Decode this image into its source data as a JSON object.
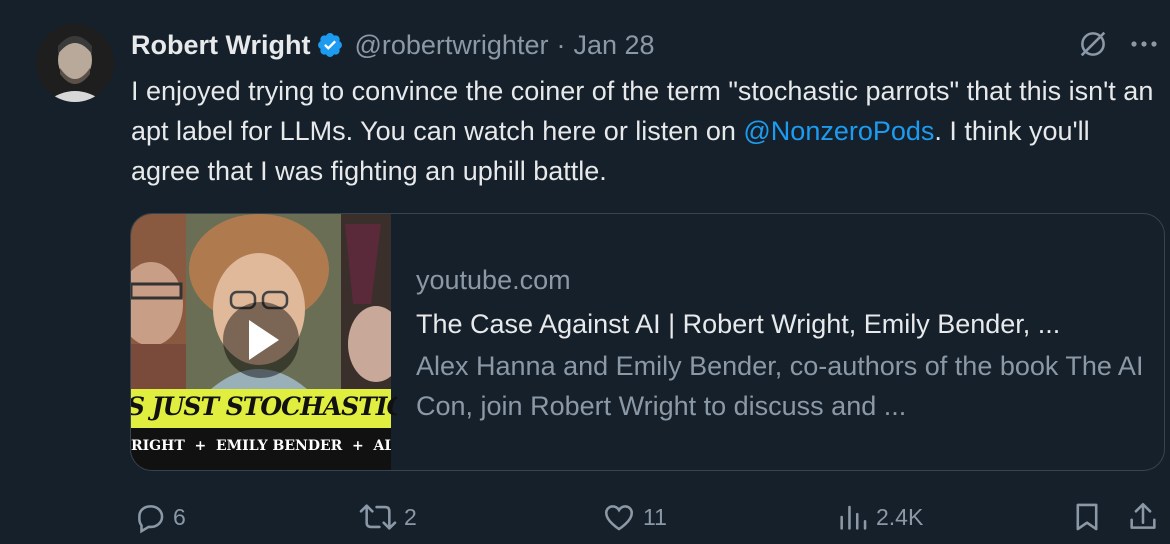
{
  "author": {
    "name": "Robert Wright",
    "handle": "@robertwrighter",
    "separator": "·",
    "date": "Jan 28"
  },
  "tweet": {
    "text_part1": "I enjoyed trying to convince the coiner of the term \"stochastic parrots\" that this isn't an apt label for LLMs. You can watch here or listen on ",
    "mention": "@NonzeroPods",
    "text_part2": ". I think you'll agree that I was fighting an uphill battle."
  },
  "card": {
    "domain": "youtube.com",
    "title": "The Case Against AI | Robert Wright, Emily Bender, ...",
    "description": "Alex Hanna and Emily Bender, co-authors of the book The AI Con, join Robert Wright to discuss and ...",
    "thumbnail_banner": "S JUST STOCHASTIC PARR",
    "thumbnail_names": "RIGHT  +  EMILY BENDER  +  AL"
  },
  "actions": {
    "replies": "6",
    "reposts": "2",
    "likes": "11",
    "views": "2.4K"
  },
  "icons": [
    "verified-badge-icon",
    "grok-icon",
    "more-icon",
    "play-icon",
    "reply-icon",
    "repost-icon",
    "like-icon",
    "views-icon",
    "bookmark-icon",
    "share-icon"
  ],
  "colors": {
    "background": "#15202b",
    "accent": "#1d9bf0",
    "muted": "#8b98a5",
    "text": "#e7e9ea",
    "banner": "#e0ef3f"
  }
}
